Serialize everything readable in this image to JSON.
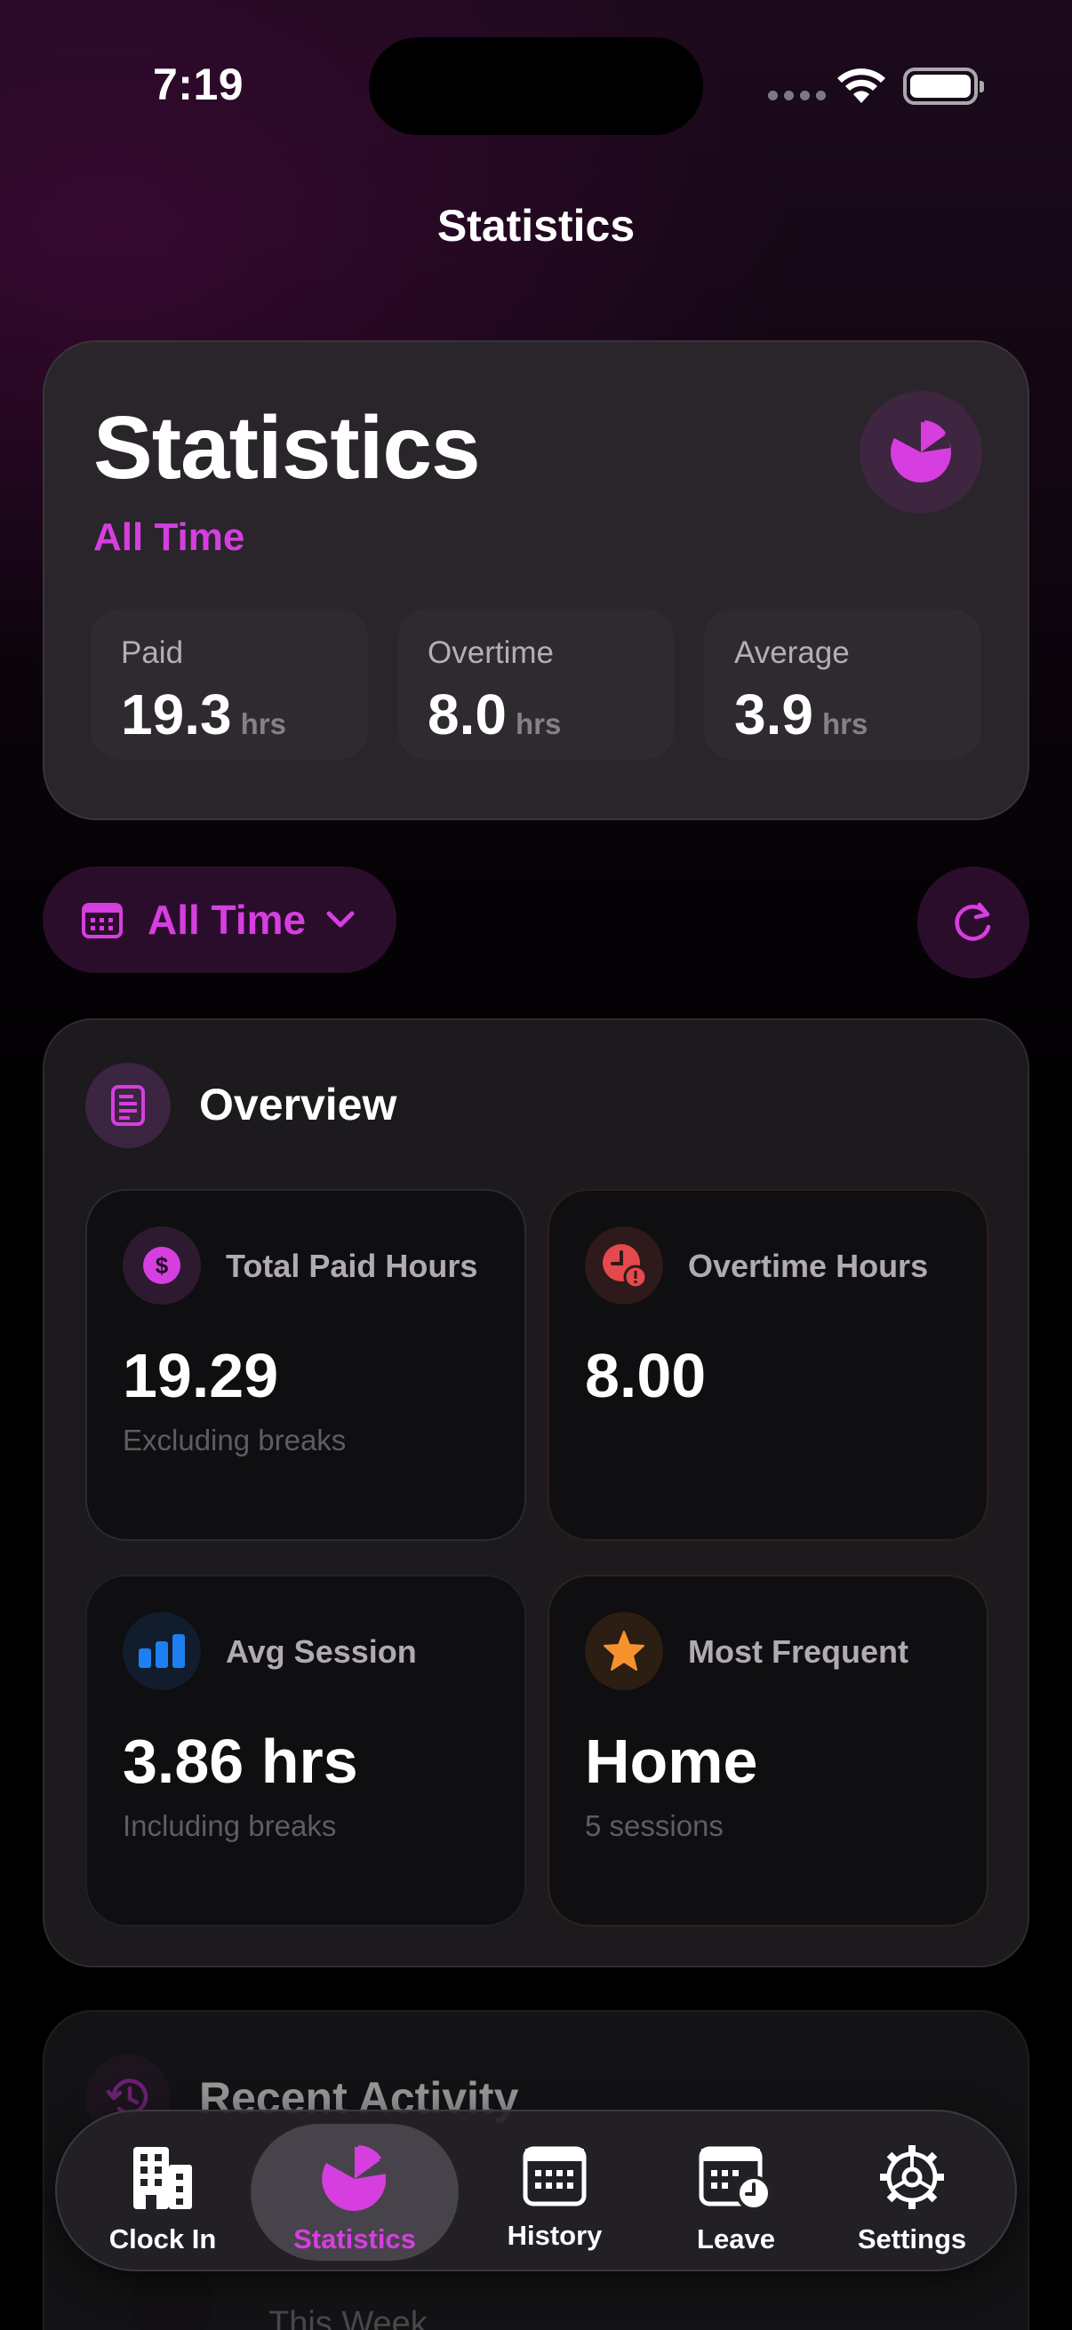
{
  "status_bar": {
    "time": "7:19"
  },
  "nav": {
    "title": "Statistics"
  },
  "hero": {
    "title": "Statistics",
    "subtitle": "All Time",
    "stats": [
      {
        "label": "Paid",
        "value": "19.3",
        "unit": "hrs"
      },
      {
        "label": "Overtime",
        "value": "8.0",
        "unit": "hrs"
      },
      {
        "label": "Average",
        "value": "3.9",
        "unit": "hrs"
      }
    ]
  },
  "filter": {
    "label": "All Time"
  },
  "overview": {
    "title": "Overview",
    "tiles": [
      {
        "label": "Total Paid Hours",
        "value": "19.29",
        "sub": "Excluding breaks",
        "icon": "dollar-icon"
      },
      {
        "label": "Overtime Hours",
        "value": "8.00",
        "sub": "",
        "icon": "overtime-clock-icon"
      },
      {
        "label": "Avg Session",
        "value": "3.86 hrs",
        "sub": "Including breaks",
        "icon": "bar-chart-icon"
      },
      {
        "label": "Most Frequent",
        "value": "Home",
        "sub": "5 sessions",
        "icon": "star-icon"
      }
    ]
  },
  "recent": {
    "title": "Recent Activity",
    "first_item": "This Week"
  },
  "tabbar": {
    "items": [
      {
        "label": "Clock In",
        "icon": "building-icon"
      },
      {
        "label": "Statistics",
        "icon": "pie-chart-icon"
      },
      {
        "label": "History",
        "icon": "calendar-icon"
      },
      {
        "label": "Leave",
        "icon": "calendar-clock-icon"
      },
      {
        "label": "Settings",
        "icon": "gear-icon"
      }
    ],
    "active_index": 1
  },
  "colors": {
    "accent": "#d63ee0",
    "overtime": "#e5484d",
    "avg": "#1e7ff0",
    "frequent": "#f5922e"
  }
}
